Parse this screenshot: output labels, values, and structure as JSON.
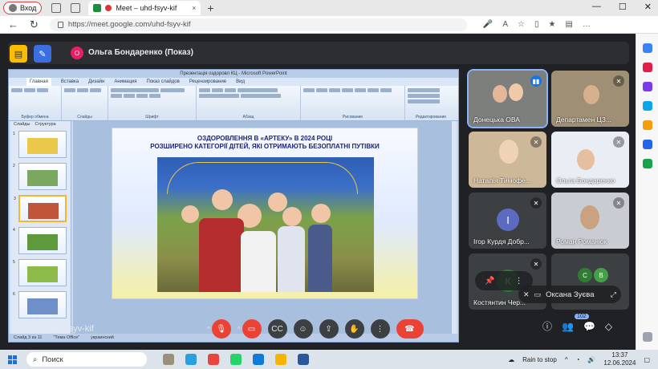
{
  "browser": {
    "profile_label": "Вход",
    "tab_title": "Meet – uhd-fsyv-kif",
    "tab_close": "×",
    "new_tab": "+",
    "url": "https://meet.google.com/uhd-fsyv-kif",
    "window_controls": [
      "—",
      "☐",
      "✕"
    ]
  },
  "share": {
    "presenter_initial": "О",
    "presenter_label": "Ольга Бондаренко (Показ)"
  },
  "powerpoint": {
    "window_title": "Презентація оздоровл КЦ - Microsoft PowerPoint",
    "tabs": [
      "Главная",
      "Вставка",
      "Дизайн",
      "Анимация",
      "Показ слайдов",
      "Рецензирование",
      "Вид"
    ],
    "groups": [
      "Буфер обмена",
      "Слайды",
      "Шрифт",
      "Абзац",
      "Рисование",
      "Редактирование"
    ],
    "thumb_tabs": [
      "Слайды",
      "Структура"
    ],
    "thumb_numbers": [
      "1",
      "2",
      "3",
      "4",
      "5",
      "6"
    ],
    "slide_title_1": "ОЗДОРОВЛЕННЯ В «АРТЕКУ» В 2024 РОЦІ",
    "slide_title_2": "РОЗШИРЕНО КАТЕГОРІЇ ДІТЕЙ, ЯКІ ОТРИМАЮТЬ БЕЗОПЛАТНІ ПУТІВКИ",
    "status": [
      "Слайд 3 из 11",
      "\"Тема Office\"",
      "украинский"
    ]
  },
  "participants": [
    {
      "name": "Донецька ОВА",
      "initial": ""
    },
    {
      "name": "Департамен ЦЗ...",
      "initial": ""
    },
    {
      "name": "Наталія Тимофе...",
      "initial": ""
    },
    {
      "name": "Ольга Бондаренко",
      "initial": ""
    },
    {
      "name": "Ігор Курдя Добр...",
      "initial": "І"
    },
    {
      "name": "Роман Романюк",
      "initial": ""
    },
    {
      "name": "Костянтин Чер...",
      "initial": "К"
    }
  ],
  "others_avatars": [
    "С",
    "В"
  ],
  "self_name": "Оксана Зуєва",
  "meeting": {
    "time": "13:37",
    "separator": "|",
    "code": "uhd-fsyv-kif",
    "participant_count": "102"
  },
  "taskbar": {
    "search_label": "Поиск",
    "weather": "Rain to stop",
    "time": "13:37",
    "date": "12.06.2024"
  },
  "colors": {
    "meet_bg": "#202124",
    "end_call": "#ea4335",
    "accent": "#1a73e8"
  },
  "icons": {
    "mic": "mic-off-icon",
    "camera": "camera-off-icon",
    "hangup": "hangup-icon"
  }
}
